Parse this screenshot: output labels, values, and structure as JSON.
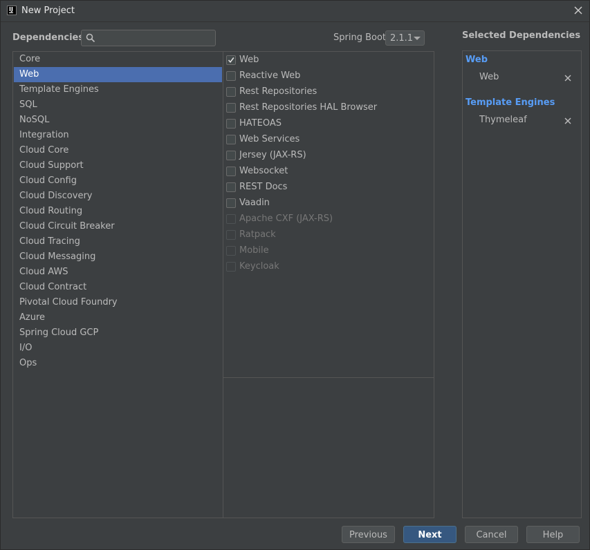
{
  "window": {
    "title": "New Project"
  },
  "header": {
    "dependencies_label": "Dependencies",
    "search_placeholder": "",
    "spring_boot_label": "Spring Boot",
    "spring_boot_version": "2.1.1"
  },
  "categories": [
    {
      "label": "Core",
      "selected": false
    },
    {
      "label": "Web",
      "selected": true
    },
    {
      "label": "Template Engines",
      "selected": false
    },
    {
      "label": "SQL",
      "selected": false
    },
    {
      "label": "NoSQL",
      "selected": false
    },
    {
      "label": "Integration",
      "selected": false
    },
    {
      "label": "Cloud Core",
      "selected": false
    },
    {
      "label": "Cloud Support",
      "selected": false
    },
    {
      "label": "Cloud Config",
      "selected": false
    },
    {
      "label": "Cloud Discovery",
      "selected": false
    },
    {
      "label": "Cloud Routing",
      "selected": false
    },
    {
      "label": "Cloud Circuit Breaker",
      "selected": false
    },
    {
      "label": "Cloud Tracing",
      "selected": false
    },
    {
      "label": "Cloud Messaging",
      "selected": false
    },
    {
      "label": "Cloud AWS",
      "selected": false
    },
    {
      "label": "Cloud Contract",
      "selected": false
    },
    {
      "label": "Pivotal Cloud Foundry",
      "selected": false
    },
    {
      "label": "Azure",
      "selected": false
    },
    {
      "label": "Spring Cloud GCP",
      "selected": false
    },
    {
      "label": "I/O",
      "selected": false
    },
    {
      "label": "Ops",
      "selected": false
    }
  ],
  "dependencies": [
    {
      "label": "Web",
      "checked": true,
      "enabled": true
    },
    {
      "label": "Reactive Web",
      "checked": false,
      "enabled": true
    },
    {
      "label": "Rest Repositories",
      "checked": false,
      "enabled": true
    },
    {
      "label": "Rest Repositories HAL Browser",
      "checked": false,
      "enabled": true
    },
    {
      "label": "HATEOAS",
      "checked": false,
      "enabled": true
    },
    {
      "label": "Web Services",
      "checked": false,
      "enabled": true
    },
    {
      "label": "Jersey (JAX-RS)",
      "checked": false,
      "enabled": true
    },
    {
      "label": "Websocket",
      "checked": false,
      "enabled": true
    },
    {
      "label": "REST Docs",
      "checked": false,
      "enabled": true
    },
    {
      "label": "Vaadin",
      "checked": false,
      "enabled": true
    },
    {
      "label": "Apache CXF (JAX-RS)",
      "checked": false,
      "enabled": false
    },
    {
      "label": "Ratpack",
      "checked": false,
      "enabled": false
    },
    {
      "label": "Mobile",
      "checked": false,
      "enabled": false
    },
    {
      "label": "Keycloak",
      "checked": false,
      "enabled": false
    }
  ],
  "selected": {
    "title": "Selected Dependencies",
    "groups": [
      {
        "name": "Web",
        "items": [
          "Web"
        ]
      },
      {
        "name": "Template Engines",
        "items": [
          "Thymeleaf"
        ]
      }
    ]
  },
  "footer": {
    "previous": "Previous",
    "next": "Next",
    "cancel": "Cancel",
    "help": "Help"
  },
  "colors": {
    "background": "#3c3f41",
    "selection": "#4b6eaf",
    "group_heading": "#589df6",
    "primary_button": "#365880"
  }
}
